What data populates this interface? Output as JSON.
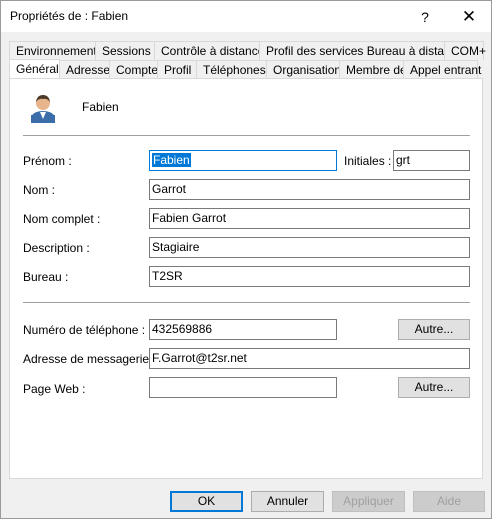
{
  "window": {
    "title": "Propriétés de : Fabien",
    "help_label": "?",
    "close_label": "✕"
  },
  "tabs_back": [
    {
      "label": "Environnement"
    },
    {
      "label": "Sessions"
    },
    {
      "label": "Contrôle à distance"
    },
    {
      "label": "Profil des services Bureau à distance"
    },
    {
      "label": "COM+"
    }
  ],
  "tabs_front": [
    {
      "label": "Général"
    },
    {
      "label": "Adresse"
    },
    {
      "label": "Compte"
    },
    {
      "label": "Profil"
    },
    {
      "label": "Téléphones"
    },
    {
      "label": "Organisation"
    },
    {
      "label": "Membre de"
    },
    {
      "label": "Appel entrant"
    }
  ],
  "active_tab": "Général",
  "user": {
    "display_name": "Fabien",
    "icon": "user-icon"
  },
  "form": {
    "prenom": {
      "label": "Prénom :",
      "value": "Fabien"
    },
    "initiales": {
      "label": "Initiales :",
      "value": "grt"
    },
    "nom": {
      "label": "Nom :",
      "value": "Garrot"
    },
    "nom_complet": {
      "label": "Nom complet :",
      "value": "Fabien Garrot"
    },
    "description": {
      "label": "Description :",
      "value": "Stagiaire"
    },
    "bureau": {
      "label": "Bureau :",
      "value": "T2SR"
    },
    "telephone": {
      "label": "Numéro de téléphone :",
      "value": "432569886",
      "button": "Autre..."
    },
    "email": {
      "label": "Adresse de messagerie :",
      "value": "F.Garrot@t2sr.net"
    },
    "page_web": {
      "label": "Page Web :",
      "value": "",
      "button": "Autre..."
    }
  },
  "footer": {
    "ok": "OK",
    "annuler": "Annuler",
    "appliquer": "Appliquer",
    "aide": "Aide"
  },
  "colors": {
    "accent": "#0078d7",
    "window_bg": "#f0f0f0",
    "panel_bg": "#ffffff"
  }
}
